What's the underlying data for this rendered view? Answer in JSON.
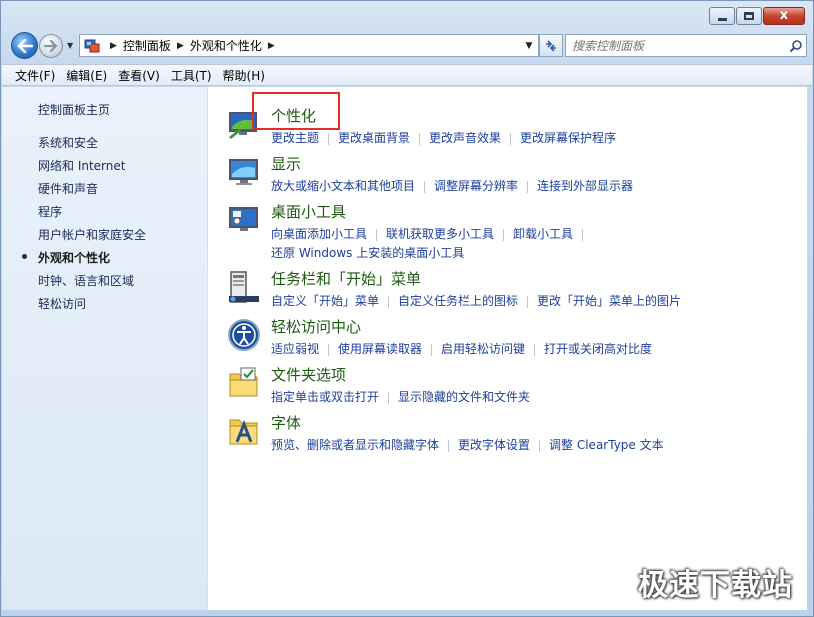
{
  "window": {
    "caption_close": "x"
  },
  "nav": {
    "breadcrumb": [
      "控制面板",
      "外观和个性化"
    ],
    "search_placeholder": "搜索控制面板"
  },
  "menu": [
    "文件(F)",
    "编辑(E)",
    "查看(V)",
    "工具(T)",
    "帮助(H)"
  ],
  "sidebar": {
    "home": "控制面板主页",
    "items": [
      "系统和安全",
      "网络和 Internet",
      "硬件和声音",
      "程序",
      "用户帐户和家庭安全",
      "外观和个性化",
      "时钟、语言和区域",
      "轻松访问"
    ],
    "active_index": 5
  },
  "categories": [
    {
      "title": "个性化",
      "icon": "personalization-icon",
      "links": [
        "更改主题",
        "更改桌面背景",
        "更改声音效果",
        "更改屏幕保护程序"
      ]
    },
    {
      "title": "显示",
      "icon": "display-icon",
      "links": [
        "放大或缩小文本和其他项目",
        "调整屏幕分辨率",
        "连接到外部显示器"
      ]
    },
    {
      "title": "桌面小工具",
      "icon": "gadgets-icon",
      "links": [
        "向桌面添加小工具",
        "联机获取更多小工具",
        "卸载小工具"
      ],
      "links2": [
        "还原 Windows 上安装的桌面小工具"
      ]
    },
    {
      "title": "任务栏和「开始」菜单",
      "icon": "taskbar-icon",
      "links": [
        "自定义「开始」菜单",
        "自定义任务栏上的图标",
        "更改「开始」菜单上的图片"
      ]
    },
    {
      "title": "轻松访问中心",
      "icon": "ease-of-access-icon",
      "links": [
        "适应弱视",
        "使用屏幕读取器",
        "启用轻松访问键",
        "打开或关闭高对比度"
      ]
    },
    {
      "title": "文件夹选项",
      "icon": "folder-options-icon",
      "links": [
        "指定单击或双击打开",
        "显示隐藏的文件和文件夹"
      ]
    },
    {
      "title": "字体",
      "icon": "fonts-icon",
      "links": [
        "预览、删除或者显示和隐藏字体",
        "更改字体设置",
        "调整 ClearType 文本"
      ]
    }
  ],
  "watermark": "极速下载站"
}
